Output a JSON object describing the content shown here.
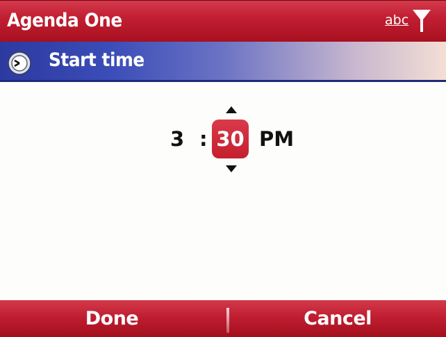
{
  "titlebar": {
    "title": "Agenda One",
    "input_mode": "abc",
    "signal_icon": "signal-icon"
  },
  "header": {
    "icon": "clock-icon",
    "label": "Start time"
  },
  "time_picker": {
    "hour": "3",
    "separator": ":",
    "minute": "30",
    "ampm": "PM",
    "up_icon": "arrow-up-icon",
    "down_icon": "arrow-down-icon"
  },
  "softkeys": {
    "left": "Done",
    "right": "Cancel"
  },
  "colors": {
    "title_bar": "#c21f33",
    "header_start": "#2c3aa0",
    "header_end": "#f3dfd4",
    "selected_field": "#c41f2e",
    "softkey_bar": "#c01e31"
  }
}
